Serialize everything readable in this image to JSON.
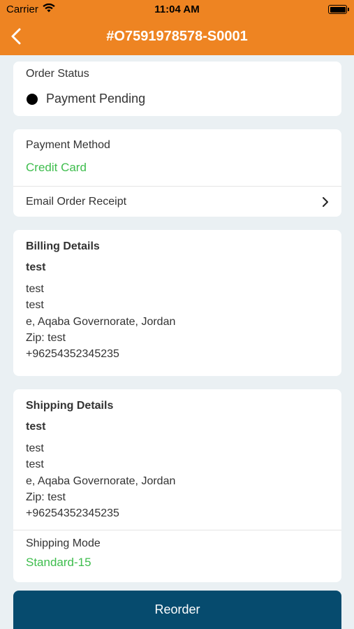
{
  "statusbar": {
    "carrier": "Carrier",
    "time": "11:04 AM"
  },
  "header": {
    "title": "#O7591978578-S0001"
  },
  "order_status": {
    "label": "Order Status",
    "value": "Payment Pending"
  },
  "payment": {
    "label": "Payment Method",
    "value": "Credit Card",
    "email_receipt": "Email Order Receipt"
  },
  "billing": {
    "title": "Billing Details",
    "name": "test",
    "lines": [
      "test",
      "test",
      "e, Aqaba Governorate, Jordan",
      "Zip: test",
      "+96254352345235"
    ]
  },
  "shipping": {
    "title": "Shipping Details",
    "name": "test",
    "lines": [
      "test",
      "test",
      "e, Aqaba Governorate, Jordan",
      "Zip: test",
      "+96254352345235"
    ],
    "mode_label": "Shipping Mode",
    "mode_value": "Standard-15"
  },
  "reorder_label": "Reorder",
  "colors": {
    "header": "#ee8422",
    "accent_green": "#3ebd4d",
    "button": "#064b6e"
  }
}
